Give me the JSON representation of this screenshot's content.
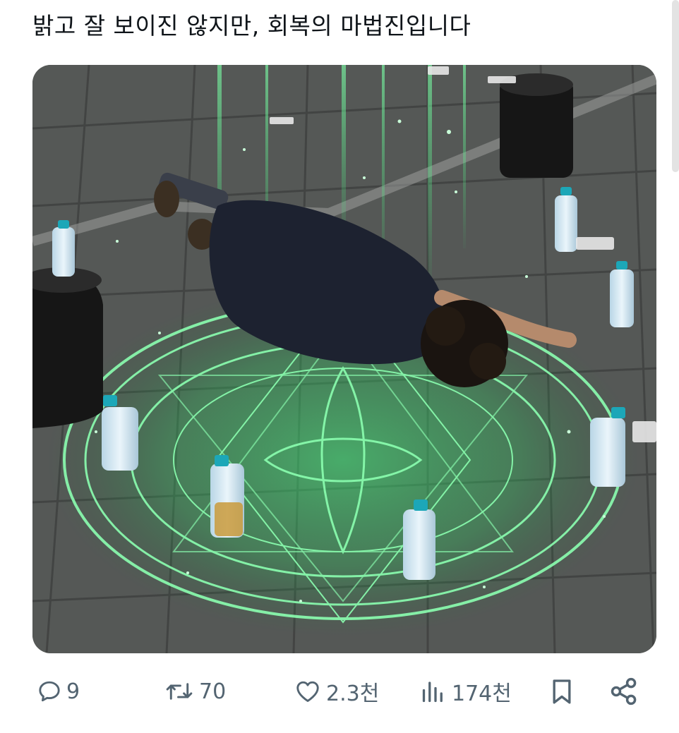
{
  "post": {
    "text": "밝고 잘 보이진 않지만, 회복의 마법진입니다"
  },
  "media": {
    "kind": "photo",
    "accent_glow": "#3ef07a"
  },
  "actions": {
    "reply": {
      "icon": "reply-icon",
      "count": "9"
    },
    "repost": {
      "icon": "repost-icon",
      "count": "70"
    },
    "like": {
      "icon": "heart-icon",
      "count": "2.3천"
    },
    "views": {
      "icon": "views-icon",
      "count": "174천"
    },
    "bookmark": {
      "icon": "bookmark-icon"
    },
    "share": {
      "icon": "share-icon"
    }
  },
  "colors": {
    "text": "#0f1419",
    "muted": "#536471"
  }
}
